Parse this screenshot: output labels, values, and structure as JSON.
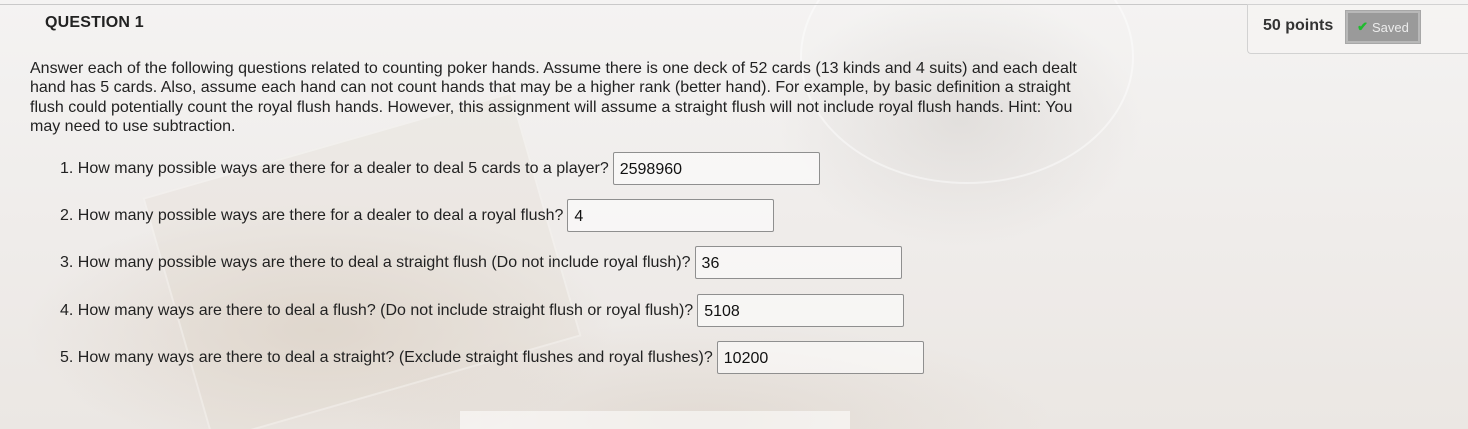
{
  "question": {
    "title": "QUESTION 1",
    "points": "50 points",
    "saved_label": "Saved",
    "saved_icon": "check-icon",
    "intro": "Answer each of the following questions related to counting poker hands. Assume there is one deck of 52 cards (13 kinds and 4 suits) and each dealt hand has 5 cards.  Also, assume each hand can not count hands that may be a higher rank (better hand).  For example, by basic definition a straight flush could potentially count the royal flush hands.  However, this assignment will assume a straight flush will not include royal flush hands.  Hint: You may need to use subtraction.",
    "items": [
      {
        "label": "1. How many possible ways are there for a dealer to deal 5 cards to a player?",
        "answer": "2598960"
      },
      {
        "label": "2. How many possible ways are there for a dealer to deal a royal flush?",
        "answer": "4"
      },
      {
        "label": "3. How many possible ways are there to deal a straight flush (Do not include royal flush)?",
        "answer": "36"
      },
      {
        "label": "4. How many ways are there to deal a flush? (Do not include straight flush or royal flush)?",
        "answer": "5108"
      },
      {
        "label": "5. How many ways are there to deal a straight? (Exclude straight flushes and royal flushes)?",
        "answer": "10200"
      }
    ]
  },
  "colors": {
    "saved_check": "#1fbb2e",
    "saved_bg": "#9a9a9a"
  }
}
